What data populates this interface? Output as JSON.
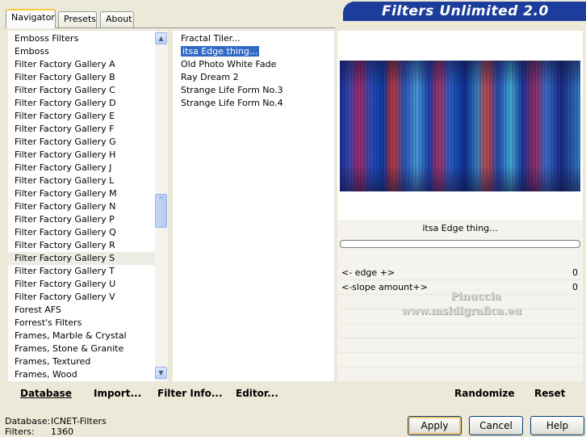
{
  "tabs": [
    {
      "label": "Navigator"
    },
    {
      "label": "Presets"
    },
    {
      "label": "About"
    }
  ],
  "banner": {
    "title": "Filters Unlimited 2.0"
  },
  "categories": [
    "Emboss Filters",
    "Emboss",
    "Filter Factory Gallery A",
    "Filter Factory Gallery B",
    "Filter Factory Gallery C",
    "Filter Factory Gallery D",
    "Filter Factory Gallery E",
    "Filter Factory Gallery F",
    "Filter Factory Gallery G",
    "Filter Factory Gallery H",
    "Filter Factory Gallery J",
    "Filter Factory Gallery L",
    "Filter Factory Gallery M",
    "Filter Factory Gallery N",
    "Filter Factory Gallery P",
    "Filter Factory Gallery Q",
    "Filter Factory Gallery R",
    "Filter Factory Gallery S",
    "Filter Factory Gallery T",
    "Filter Factory Gallery U",
    "Filter Factory Gallery V",
    "Forest AFS",
    "Forrest's Filters",
    "Frames, Marble & Crystal",
    "Frames, Stone & Granite",
    "Frames, Textured",
    "Frames, Wood"
  ],
  "selected_category": "Filter Factory Gallery S",
  "filters": [
    "Fractal Tiler...",
    "itsa Edge thing...",
    "Old Photo White Fade",
    "Ray Dream 2",
    "Strange Life Form No.3",
    "Strange Life Form No.4"
  ],
  "selected_filter": "itsa Edge thing...",
  "preview_caption": "itsa Edge thing...",
  "params": [
    {
      "label": "<- edge +>",
      "value": "0"
    },
    {
      "label": "<-slope amount+>",
      "value": "0"
    }
  ],
  "watermark": {
    "line1": "Pinuccia",
    "line2": "www.msldlgrafica.eu"
  },
  "bottom_toolbar": {
    "database": "Database",
    "import": "Import...",
    "filter_info": "Filter Info...",
    "editor": "Editor...",
    "randomize": "Randomize",
    "reset": "Reset"
  },
  "status": {
    "database_label": "Database:",
    "database_value": "ICNET-Filters",
    "filters_label": "Filters:",
    "filters_value": "1360"
  },
  "buttons": {
    "apply": "Apply",
    "cancel": "Cancel",
    "help": "Help"
  },
  "scrollbar_position": 0.52
}
